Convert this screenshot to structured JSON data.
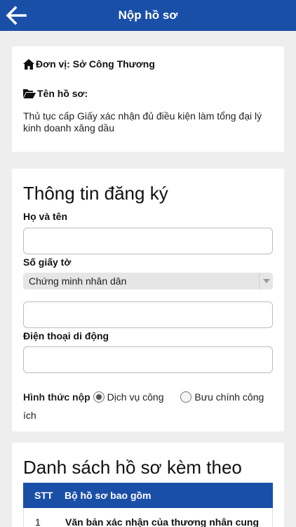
{
  "header": {
    "title": "Nộp hồ sơ"
  },
  "agency": {
    "label": "Đơn vị: Sở Công Thương"
  },
  "dossier": {
    "label": "Tên hồ sơ:",
    "text": "Thủ tục cấp Giấy xác nhận đủ điều kiện làm tổng đại lý kinh doanh xăng dầu"
  },
  "registration": {
    "title": "Thông tin đăng ký",
    "full_name_label": "Họ và tên",
    "full_name_value": "",
    "id_label": "Số giấy tờ",
    "id_type_selected": "Chứng minh nhân dân",
    "id_number_value": "",
    "phone_label": "Điện thoại di động",
    "phone_value": "",
    "submit_method_label": "Hình thức nộp",
    "submit_options": [
      "Dịch vụ công",
      "Bưu chính công ích"
    ]
  },
  "attachments": {
    "title": "Danh sách hồ sơ kèm theo",
    "columns": [
      "STT",
      "Bộ hồ sơ bao gồm"
    ],
    "rows": [
      {
        "stt": "1",
        "document": "Văn bản xác nhận của thương nhân cung"
      }
    ]
  },
  "colors": {
    "primary": "#1a4fa8",
    "background": "#eeeeee"
  },
  "icons": {
    "back": "arrow-left-icon",
    "home": "home-icon",
    "folder": "folder-open-icon",
    "dropdown": "chevron-down-icon"
  }
}
